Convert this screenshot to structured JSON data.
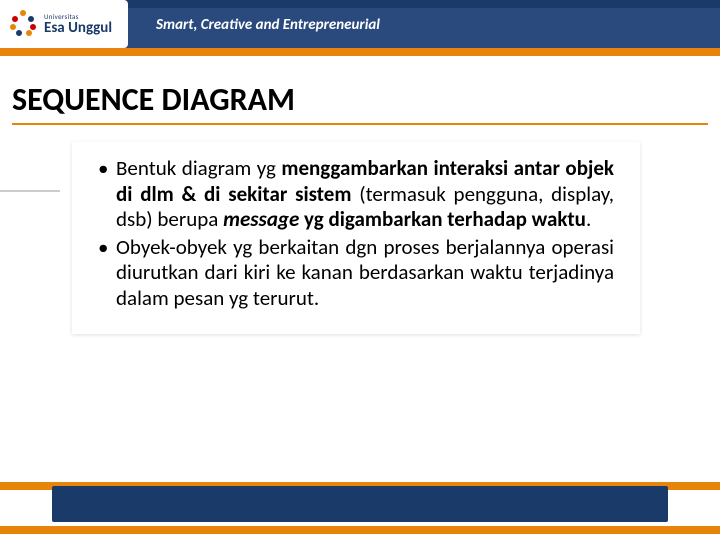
{
  "brand": {
    "small": "Universitas",
    "name": "Esa Unggul",
    "tagline": "Smart, Creative and Entrepreneurial"
  },
  "title": "SEQUENCE DIAGRAM",
  "bullets": [
    {
      "mark": "•",
      "runs": [
        {
          "t": "Bentuk diagram yg ",
          "b": false,
          "i": false
        },
        {
          "t": "menggambarkan interaksi antar objek di dlm & di sekitar sistem",
          "b": true,
          "i": false
        },
        {
          "t": " (termasuk pengguna, display, dsb) berupa ",
          "b": false,
          "i": false
        },
        {
          "t": "message",
          "b": true,
          "i": true
        },
        {
          "t": " yg digambarkan terhadap waktu",
          "b": true,
          "i": false
        },
        {
          "t": ".",
          "b": false,
          "i": false
        }
      ]
    },
    {
      "mark": "•",
      "runs": [
        {
          "t": "Obyek-obyek yg berkaitan dgn proses berjalannya operasi diurutkan dari kiri ke kanan berdasarkan waktu terjadinya dalam pesan yg terurut.",
          "b": false,
          "i": false
        }
      ]
    }
  ]
}
